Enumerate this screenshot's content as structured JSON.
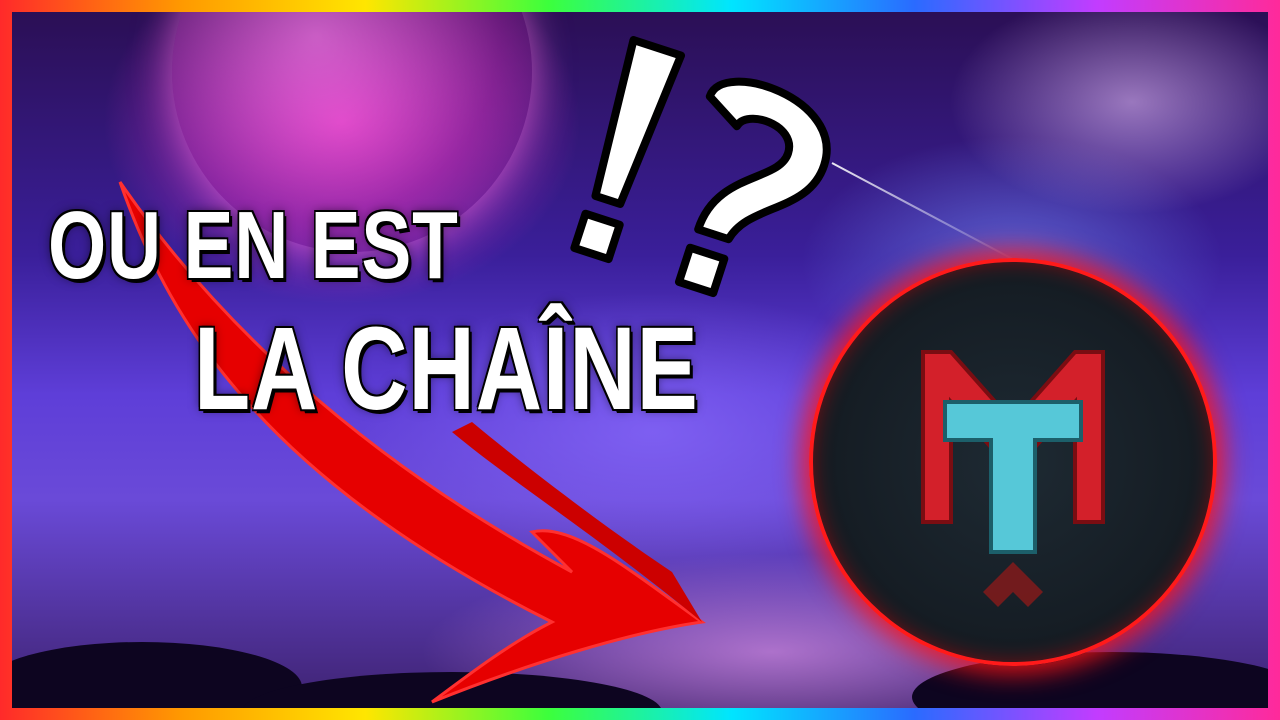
{
  "thumbnail": {
    "headline_line1": "OU EN EST",
    "headline_line2": "LA CHAÎNE",
    "logo_mark": "!?",
    "badge_letters": [
      "M",
      "T"
    ]
  },
  "colors": {
    "border_gradient": [
      "#ff2a2a",
      "#ff9a00",
      "#ffe600",
      "#3cff3c",
      "#00e5ff",
      "#2a6bff",
      "#c23cff",
      "#ff2a9a"
    ],
    "arrow": "#e60000",
    "badge_ring": "#ff1a1a",
    "badge_m": "#d3202a",
    "badge_t": "#56c8d8",
    "text": "#ffffff"
  },
  "icons": [
    "exclamation-question-icon",
    "red-arrow-icon",
    "channel-logo-icon"
  ]
}
